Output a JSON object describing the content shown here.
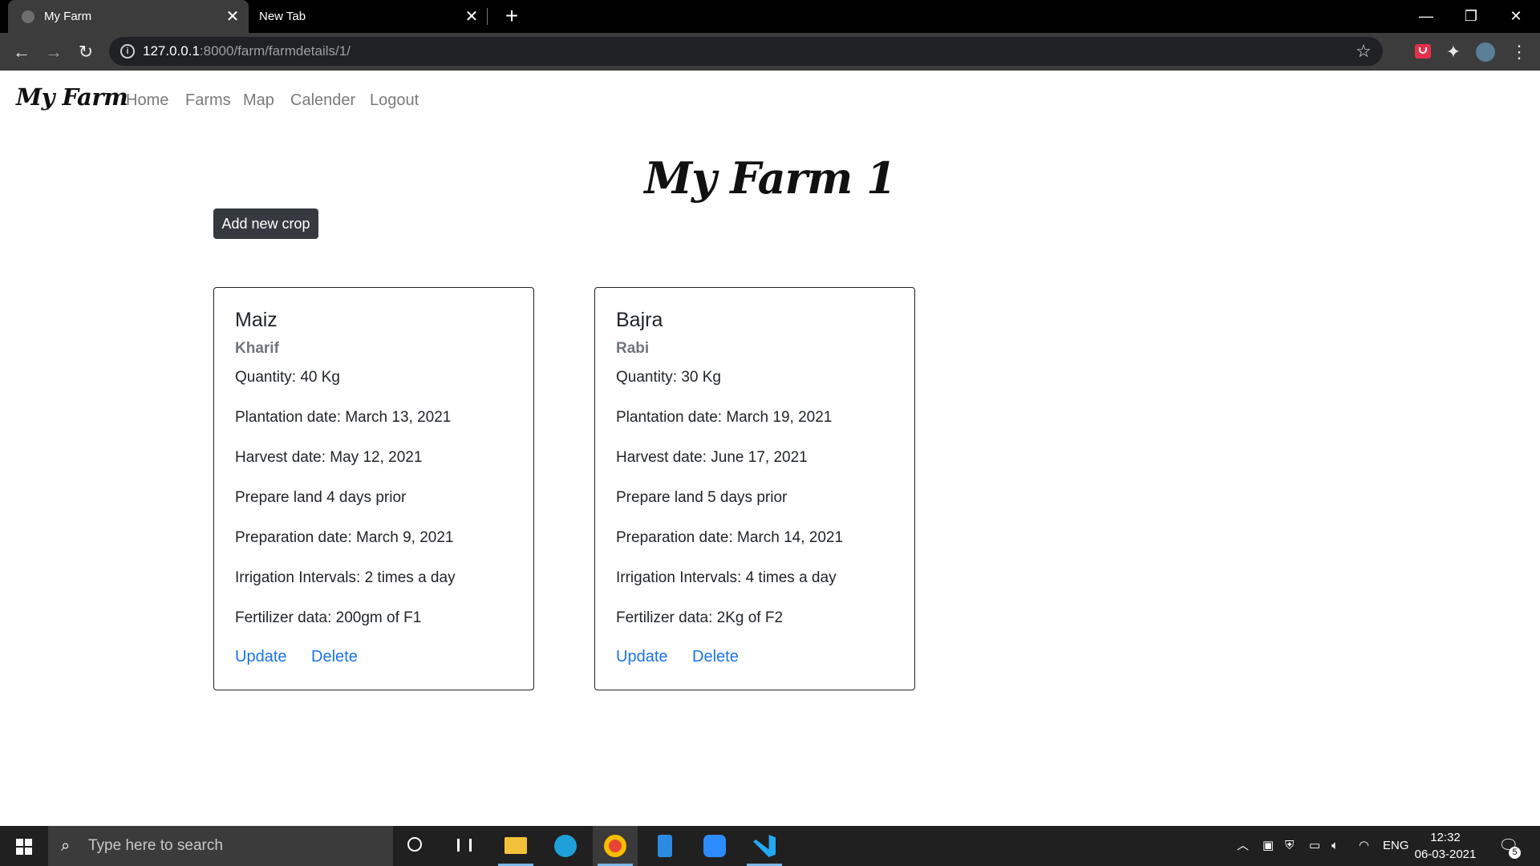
{
  "browser": {
    "tabs": [
      {
        "title": "My Farm",
        "active": true
      },
      {
        "title": "New Tab",
        "active": false
      }
    ],
    "url": {
      "host": "127.0.0.1",
      "path": ":8000/farm/farmdetails/1/"
    }
  },
  "navbar": {
    "brand": "My Farm",
    "links": [
      "Home",
      "Farms",
      "Map",
      "Calender",
      "Logout"
    ]
  },
  "page": {
    "title": "My Farm 1",
    "add_button": "Add new crop"
  },
  "crops": [
    {
      "name": "Maiz",
      "season": "Kharif",
      "quantity": "Quantity: 40 Kg",
      "plantation": "Plantation date: March 13, 2021",
      "harvest": "Harvest date: May 12, 2021",
      "prepare": "Prepare land 4 days prior",
      "preparation": "Preparation date: March 9, 2021",
      "irrigation": "Irrigation Intervals: 2 times a day",
      "fertilizer": "Fertilizer data: 200gm of F1",
      "update_label": "Update",
      "delete_label": "Delete"
    },
    {
      "name": "Bajra",
      "season": "Rabi",
      "quantity": "Quantity: 30 Kg",
      "plantation": "Plantation date: March 19, 2021",
      "harvest": "Harvest date: June 17, 2021",
      "prepare": "Prepare land 5 days prior",
      "preparation": "Preparation date: March 14, 2021",
      "irrigation": "Irrigation Intervals: 4 times a day",
      "fertilizer": "Fertilizer data: 2Kg of F2",
      "update_label": "Update",
      "delete_label": "Delete"
    }
  ],
  "taskbar": {
    "search_placeholder": "Type here to search",
    "language": "ENG",
    "time": "12:32",
    "date": "06-03-2021",
    "notification_count": "5"
  },
  "colors": {
    "link": "#1a73e8",
    "button_dark": "#343a40",
    "season_text": "#6c757d"
  }
}
